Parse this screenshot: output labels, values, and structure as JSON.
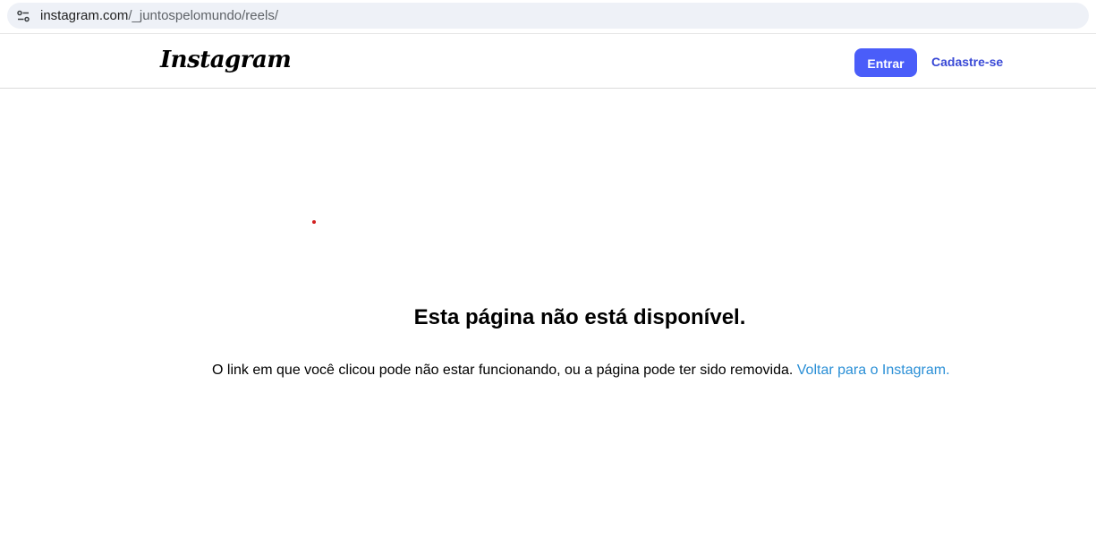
{
  "browser": {
    "url_host": "instagram.com",
    "url_path": "/_juntospelomundo/reels/",
    "site_info_icon": "tune-icon"
  },
  "header": {
    "logo_text": "Instagram",
    "login_label": "Entrar",
    "signup_label": "Cadastre-se"
  },
  "error": {
    "title": "Esta página não está disponível.",
    "message": "O link em que você clicou pode não estar funcionando, ou a página pode ter sido removida. ",
    "back_link": "Voltar para o Instagram."
  },
  "colors": {
    "primary_button": "#4a5df9",
    "link": "#2a8fd6",
    "signup_link": "#3949d6"
  }
}
